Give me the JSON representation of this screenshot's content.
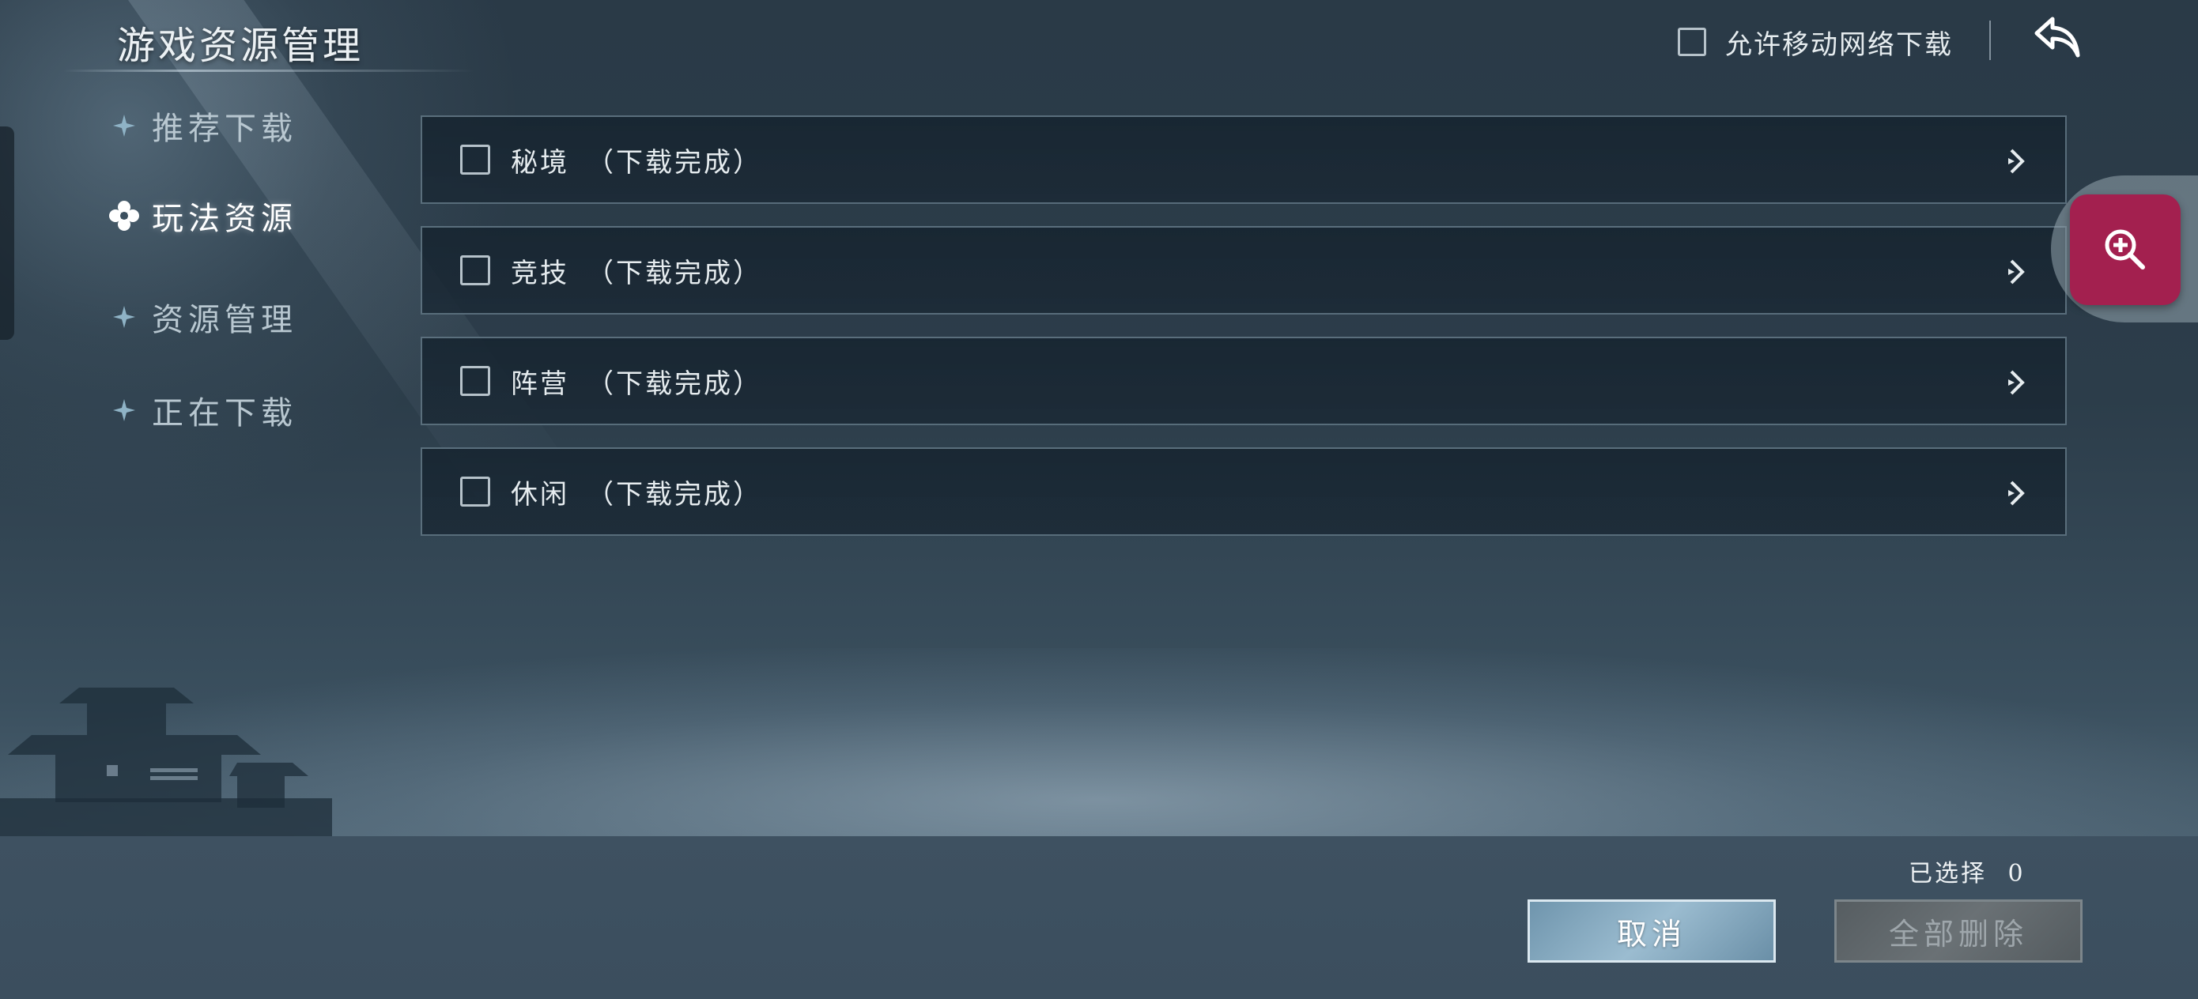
{
  "header": {
    "title": "游戏资源管理",
    "mobile_download_label": "允许移动网络下载",
    "mobile_download_checked": false,
    "back_icon": "back-arrow-icon"
  },
  "sidebar": {
    "items": [
      {
        "label": "推荐下载",
        "active": false,
        "icon": "sparkle-icon"
      },
      {
        "label": "玩法资源",
        "active": true,
        "icon": "sparkle-icon"
      },
      {
        "label": "资源管理",
        "active": false,
        "icon": "sparkle-icon"
      },
      {
        "label": "正在下载",
        "active": false,
        "icon": "sparkle-icon"
      }
    ]
  },
  "resources": [
    {
      "name": "秘境",
      "status": "（下载完成）",
      "checked": false
    },
    {
      "name": "竞技",
      "status": "（下载完成）",
      "checked": false
    },
    {
      "name": "阵营",
      "status": "（下载完成）",
      "checked": false
    },
    {
      "name": "休闲",
      "status": "（下载完成）",
      "checked": false
    }
  ],
  "footer": {
    "selected_label": "已选择",
    "selected_count": "0",
    "cancel_label": "取消",
    "delete_all_label": "全部删除"
  },
  "floating": {
    "zoom_icon": "zoom-in-icon",
    "zoom_color": "#a3204f"
  }
}
